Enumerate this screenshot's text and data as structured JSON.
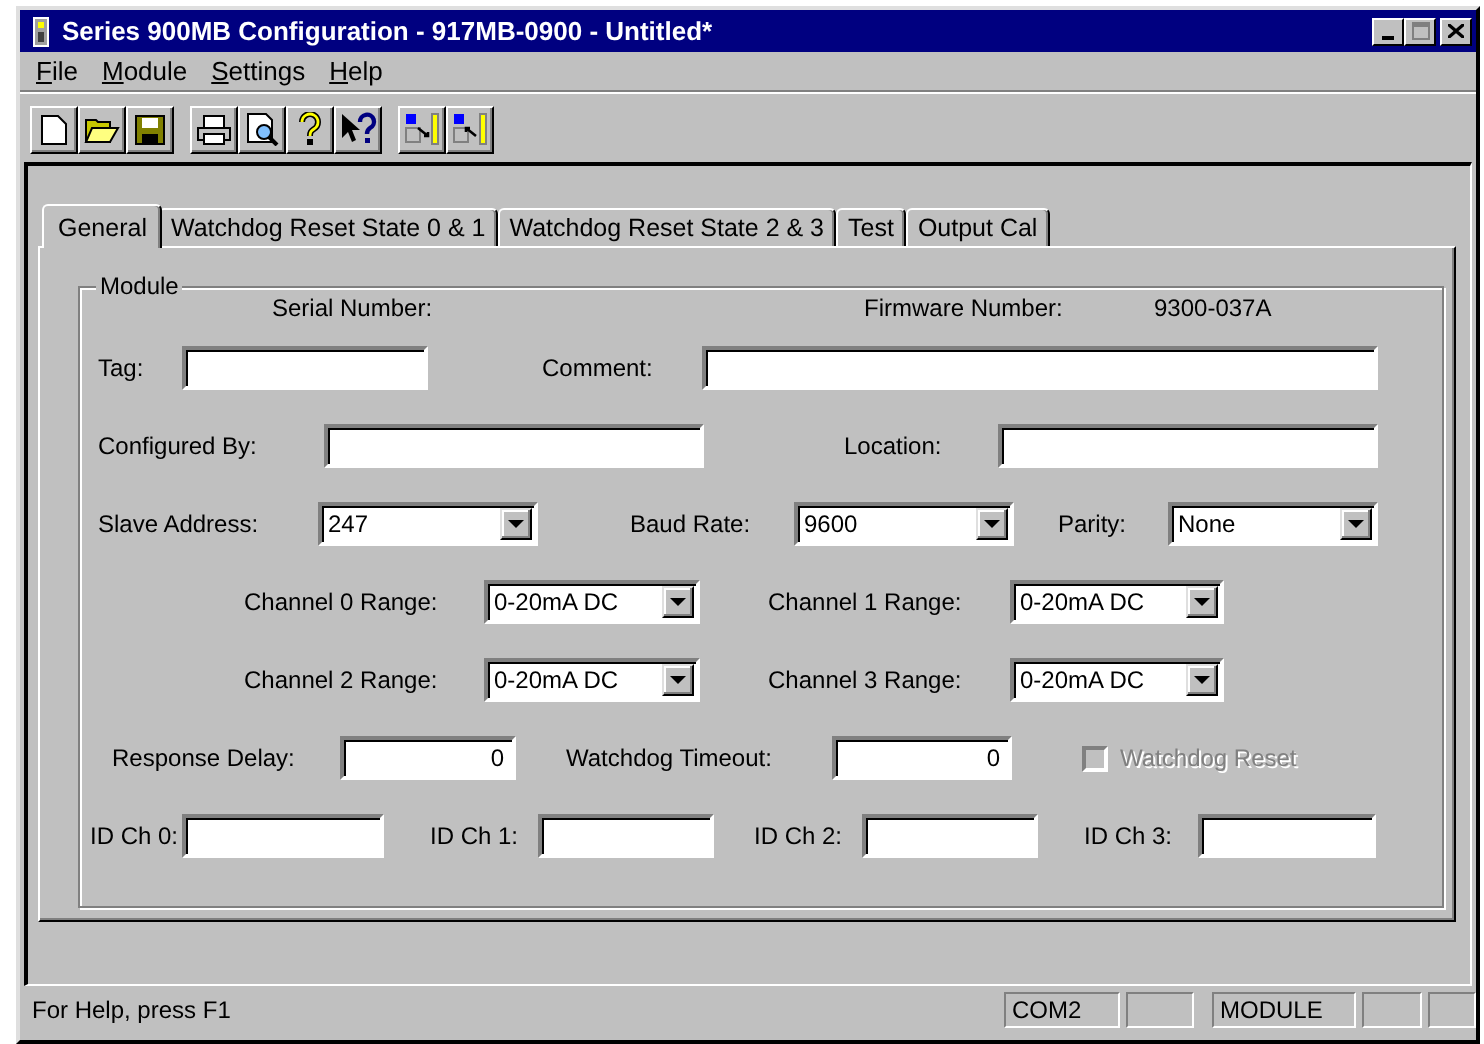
{
  "window": {
    "title": "Series 900MB Configuration - 917MB-0900 - Untitled*"
  },
  "menu": [
    "File",
    "Module",
    "Settings",
    "Help"
  ],
  "tabs": [
    {
      "label": "General",
      "selected": true
    },
    {
      "label": "Watchdog Reset State 0 & 1",
      "selected": false
    },
    {
      "label": "Watchdog Reset State 2 & 3",
      "selected": false
    },
    {
      "label": "Test",
      "selected": false
    },
    {
      "label": "Output Cal",
      "selected": false
    }
  ],
  "module": {
    "legend": "Module",
    "serial_label": "Serial Number:",
    "firmware_label": "Firmware Number:",
    "firmware_value": "9300-037A",
    "tag": {
      "label": "Tag:"
    },
    "comment": {
      "label": "Comment:"
    },
    "configured_by": {
      "label": "Configured By:"
    },
    "location": {
      "label": "Location:"
    },
    "slave_address": {
      "label": "Slave Address:",
      "value": "247"
    },
    "baud_rate": {
      "label": "Baud Rate:",
      "value": "9600"
    },
    "parity": {
      "label": "Parity:",
      "value": "None"
    },
    "channel_ranges": [
      {
        "label": "Channel 0 Range:",
        "value": "0-20mA DC"
      },
      {
        "label": "Channel 1 Range:",
        "value": "0-20mA DC"
      },
      {
        "label": "Channel 2 Range:",
        "value": "0-20mA DC"
      },
      {
        "label": "Channel 3 Range:",
        "value": "0-20mA DC"
      }
    ],
    "response_delay": {
      "label": "Response Delay:",
      "value": "0"
    },
    "watchdog_timeout": {
      "label": "Watchdog Timeout:",
      "value": "0"
    },
    "watchdog_reset": {
      "label": "Watchdog Reset",
      "checked": false,
      "disabled": true
    },
    "id_channels": [
      {
        "label": "ID Ch 0:"
      },
      {
        "label": "ID Ch 1:"
      },
      {
        "label": "ID Ch 2:"
      },
      {
        "label": "ID Ch 3:"
      }
    ]
  },
  "status_bar": {
    "message": "For Help, press F1",
    "panes": [
      "COM2",
      "MODULE"
    ]
  }
}
